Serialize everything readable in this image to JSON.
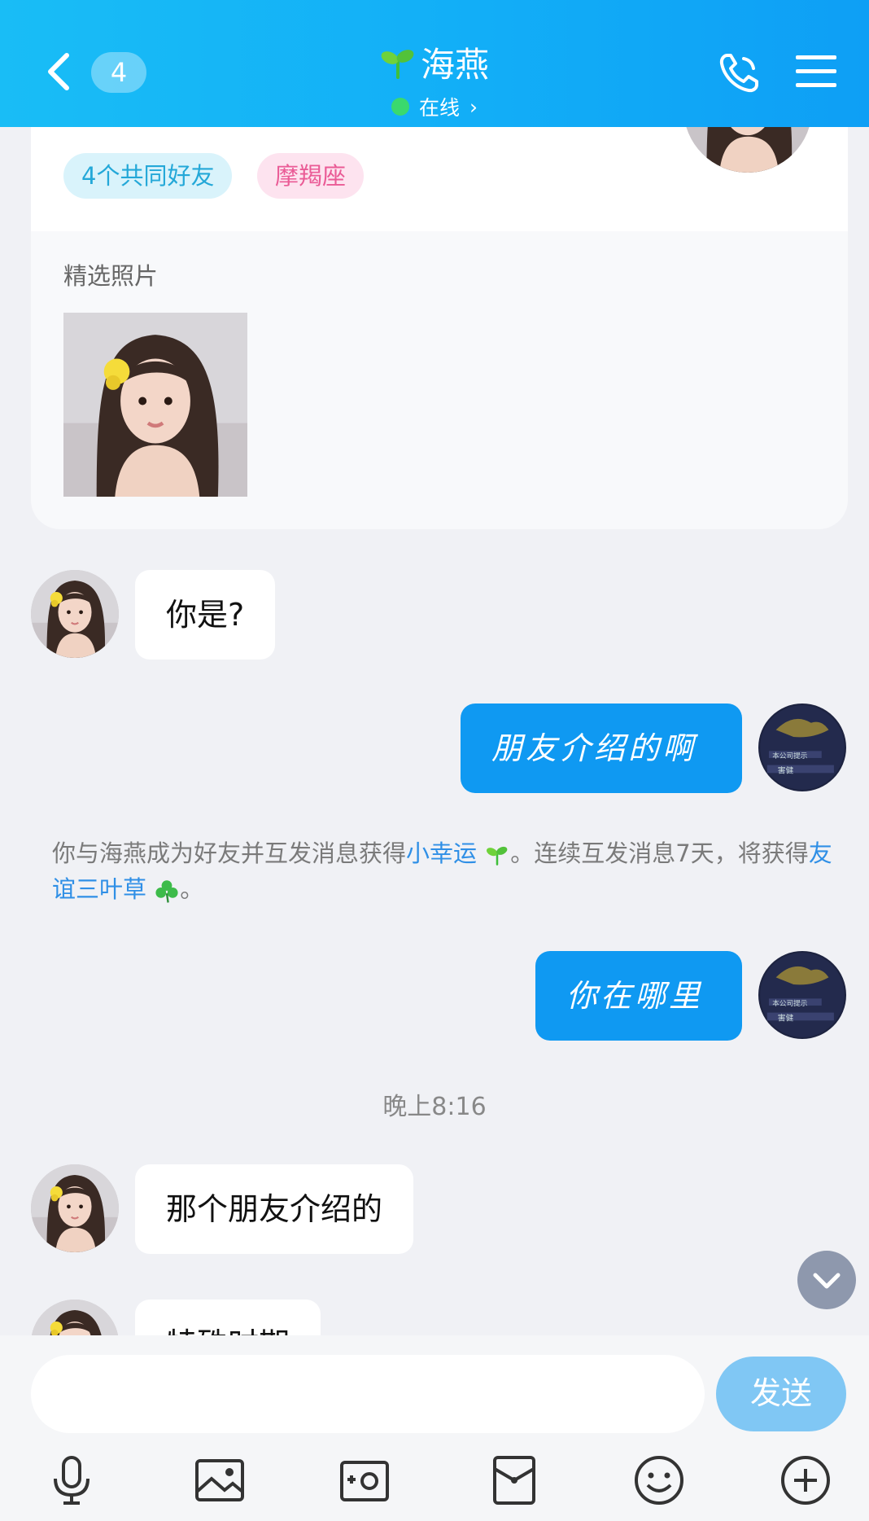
{
  "header": {
    "unread_count": "4",
    "title": "海燕",
    "status": "在线",
    "status_chevron": "›",
    "icons": [
      "back-icon",
      "sprout-icon",
      "phone-icon",
      "menu-icon"
    ]
  },
  "profile": {
    "tags": [
      "4个共同好友",
      "摩羯座"
    ],
    "photos_label": "精选照片"
  },
  "messages": [
    {
      "side": "in",
      "text": "你是?"
    },
    {
      "side": "out",
      "text": "朋友介绍的啊"
    },
    {
      "side": "out",
      "text": "你在哪里"
    },
    {
      "side": "in",
      "text": "那个朋友介绍的"
    },
    {
      "side": "in",
      "text": "特殊时期"
    }
  ],
  "system_notice": {
    "part1": "你与海燕成为好友并互发消息获得",
    "link1": "小幸运",
    "part2": "。连续互发消息7天，将获得",
    "link2": "友谊三叶草",
    "part3": "。"
  },
  "time_divider": "晚上8:16",
  "input": {
    "placeholder": "",
    "send_label": "发送",
    "tools": [
      "microphone-icon",
      "image-icon",
      "camera-icon",
      "red-packet-icon",
      "emoji-icon",
      "plus-icon"
    ]
  },
  "colors": {
    "header_start": "#19bdf6",
    "header_end": "#0e9ff5",
    "outgoing_bubble": "#0f99f2",
    "link": "#2f8fe6",
    "online": "#3ad96e"
  }
}
